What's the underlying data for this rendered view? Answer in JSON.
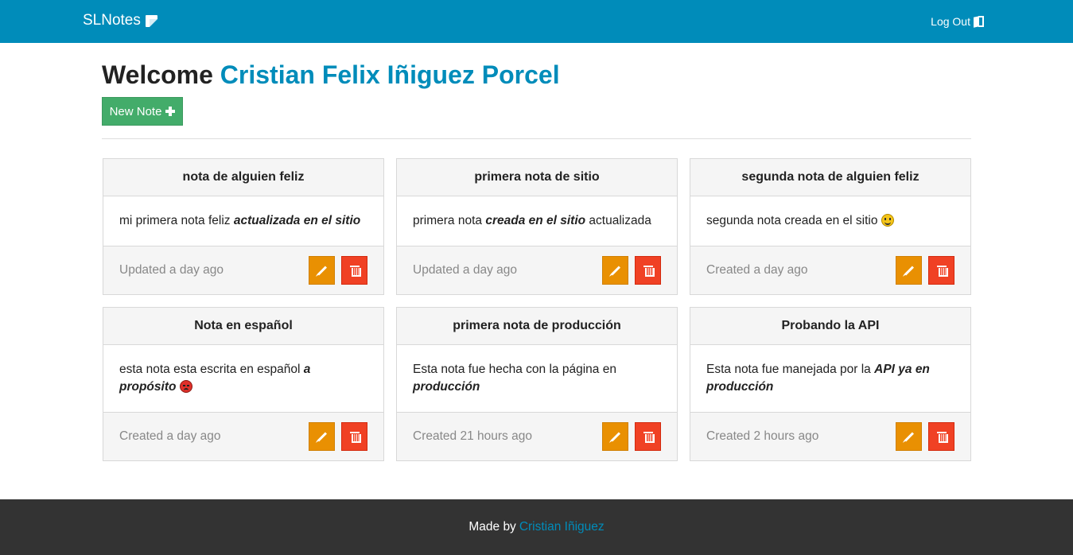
{
  "colors": {
    "navbar": "#008cba",
    "accent": "#008cba",
    "success": "#43ac6a",
    "warning": "#e99002",
    "danger": "#f04124",
    "footer": "#333333"
  },
  "navbar": {
    "brand": "SLNotes",
    "brand_icon": "note-icon",
    "logout_label": "Log Out",
    "logout_icon": "door-exit-icon"
  },
  "main": {
    "welcome_prefix": "Welcome",
    "user_name": "Cristian Felix Iñiguez Porcel",
    "new_note_label": "New Note",
    "new_note_icon": "plus-icon"
  },
  "notes": [
    {
      "title": "nota de alguien feliz",
      "body": [
        {
          "text": "mi primera nota feliz "
        },
        {
          "text": "actualizada en el sitio",
          "emphasis": true
        }
      ],
      "status": "Updated a day ago"
    },
    {
      "title": "primera nota de sitio",
      "body": [
        {
          "text": "primera nota "
        },
        {
          "text": "creada en el sitio",
          "emphasis": true
        },
        {
          "text": " actualizada"
        }
      ],
      "status": "Updated a day ago"
    },
    {
      "title": "segunda nota de alguien feliz",
      "body": [
        {
          "text": "segunda nota creada en el sitio "
        },
        {
          "emoji": "happy-face-emoji"
        }
      ],
      "status": "Created a day ago"
    },
    {
      "title": "Nota en español",
      "body": [
        {
          "text": "esta nota esta escrita en español "
        },
        {
          "text": "a propósito",
          "emphasis": true
        },
        {
          "text": " "
        },
        {
          "emoji": "angry-face-emoji"
        }
      ],
      "status": "Created a day ago"
    },
    {
      "title": "primera nota de producción",
      "body": [
        {
          "text": "Esta nota fue hecha con la página en "
        },
        {
          "text": "producción",
          "emphasis": true
        }
      ],
      "status": "Created 21 hours ago"
    },
    {
      "title": "Probando la API",
      "body": [
        {
          "text": "Esta nota fue manejada por la "
        },
        {
          "text": "API ya en producción",
          "emphasis": true
        }
      ],
      "status": "Created 2 hours ago"
    }
  ],
  "card_actions": {
    "edit_icon": "pencil-icon",
    "delete_icon": "trash-icon"
  },
  "footer": {
    "prefix": "Made by",
    "author": "Cristian Iñiguez"
  }
}
